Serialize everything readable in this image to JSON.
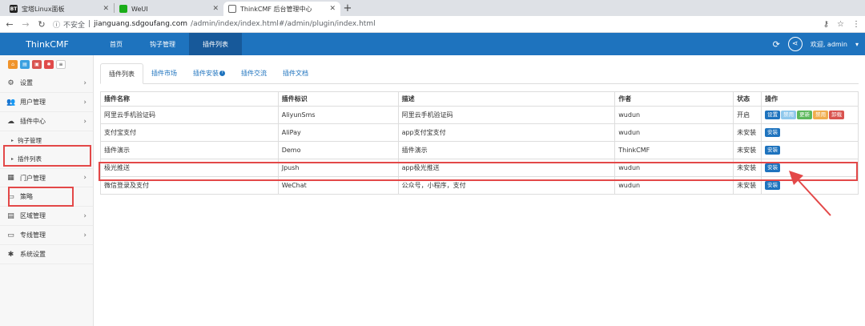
{
  "browser": {
    "tabs": [
      {
        "label": "宝塔Linux面板",
        "icon": "bt-icon"
      },
      {
        "label": "WeUI",
        "icon": "wechat-icon"
      },
      {
        "label": "ThinkCMF 后台管理中心",
        "icon": "globe-icon",
        "active": true
      }
    ],
    "insecure_label": "不安全",
    "url_host": "jianguang.sdgoufang.com",
    "url_path": "/admin/index/index.html#/admin/plugin/index.html"
  },
  "header": {
    "brand": "ThinkCMF",
    "nav": [
      "首页",
      "钩子管理",
      "插件列表"
    ],
    "active_nav": 2,
    "welcome": "欢迎, admin",
    "accent": "#1e73be"
  },
  "sidebar": {
    "items": [
      {
        "label": "设置",
        "icon": "gears-icon"
      },
      {
        "label": "用户管理",
        "icon": "users-icon"
      },
      {
        "label": "插件中心",
        "icon": "cloud-icon"
      }
    ],
    "sub_items": [
      "钩子管理",
      "插件列表"
    ],
    "items_after": [
      {
        "label": "门户管理",
        "icon": "grid-icon",
        "chev": true
      },
      {
        "label": "策略",
        "icon": "monitor-icon",
        "chev": false
      },
      {
        "label": "区域管理",
        "icon": "calendar-icon",
        "chev": true
      },
      {
        "label": "专线管理",
        "icon": "monitor-icon",
        "chev": true
      },
      {
        "label": "系统设置",
        "icon": "gear-icon",
        "chev": false
      }
    ]
  },
  "content": {
    "tabs": [
      "插件列表",
      "插件市场",
      "插件安装",
      "插件交流",
      "插件文档"
    ],
    "table": {
      "headers": [
        "插件名称",
        "插件标识",
        "描述",
        "作者",
        "状态",
        "操作"
      ],
      "rows": [
        {
          "name": "阿里云手机验证码",
          "id": "AliyunSms",
          "desc": "阿里云手机验证码",
          "author": "wudun",
          "status": "开启",
          "actions": [
            "设置",
            "禁用",
            "更新",
            "禁用",
            "卸载"
          ]
        },
        {
          "name": "支付宝支付",
          "id": "AliPay",
          "desc": "app支付宝支付",
          "author": "wudun",
          "status": "未安装",
          "actions": [
            "安装"
          ]
        },
        {
          "name": "插件演示",
          "id": "Demo",
          "desc": "插件演示",
          "author": "ThinkCMF",
          "status": "未安装",
          "actions": [
            "安装"
          ]
        },
        {
          "name": "极光推送",
          "id": "Jpush",
          "desc": "app极光推送",
          "author": "wudun",
          "status": "未安装",
          "actions": [
            "安装"
          ]
        },
        {
          "name": "微信登录及支付",
          "id": "WeChat",
          "desc": "公众号，小程序，支付",
          "author": "wudun",
          "status": "未安装",
          "actions": [
            "安装"
          ]
        }
      ]
    }
  }
}
